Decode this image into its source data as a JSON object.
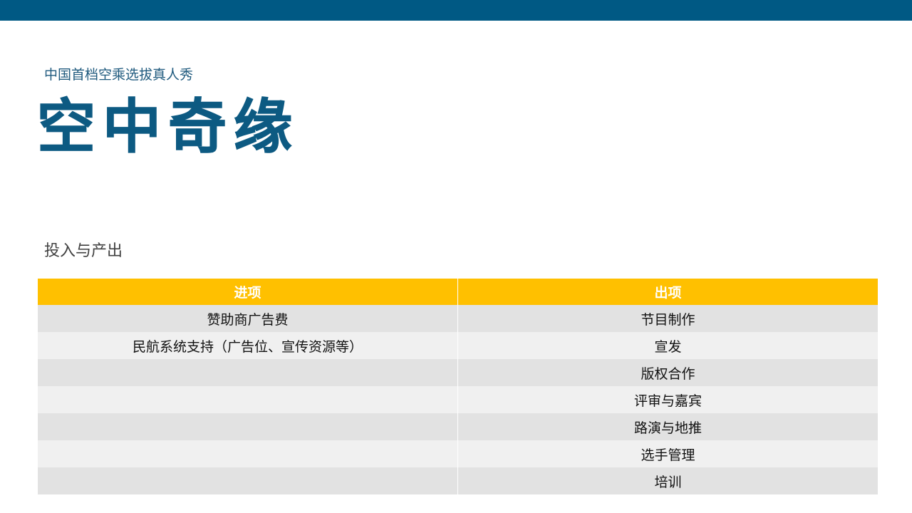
{
  "header": {
    "subtitle": "中国首档空乘选拔真人秀",
    "title": "空中奇缘"
  },
  "section": {
    "label": "投入与产出"
  },
  "table": {
    "headers": [
      "进项",
      "出项"
    ],
    "rows": [
      [
        "赞助商广告费",
        "节目制作"
      ],
      [
        "民航系统支持（广告位、宣传资源等）",
        "宣发"
      ],
      [
        "",
        "版权合作"
      ],
      [
        "",
        "评审与嘉宾"
      ],
      [
        "",
        "路演与地推"
      ],
      [
        "",
        "选手管理"
      ],
      [
        "",
        "培训"
      ]
    ]
  },
  "colors": {
    "top_bar": "#005984",
    "title": "#0d5a82",
    "header_fill": "#ffc000",
    "row_dark": "#e2e2e2",
    "row_light": "#f0f0f0"
  }
}
